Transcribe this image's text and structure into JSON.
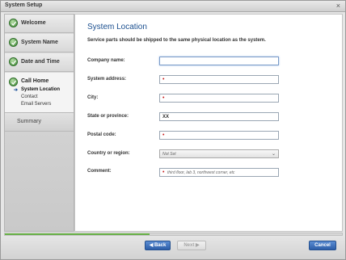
{
  "window": {
    "title": "System Setup",
    "close_glyph": "×"
  },
  "sidebar": {
    "steps": [
      {
        "label": "Welcome",
        "icon": "check-circle-icon"
      },
      {
        "label": "System Name",
        "icon": "check-circle-icon"
      },
      {
        "label": "Date and Time",
        "icon": "check-circle-icon"
      }
    ],
    "current": {
      "label": "Call Home",
      "icon": "check-circle-icon",
      "substeps": [
        {
          "label": "System Location",
          "active": true
        },
        {
          "label": "Contact",
          "active": false
        },
        {
          "label": "Email Servers",
          "active": false
        }
      ]
    },
    "summary": "Summary"
  },
  "main": {
    "title": "System Location",
    "description": "Service parts should be shipped to the same physical location as the system.",
    "fields": [
      {
        "label": "Company name:",
        "value": "",
        "required": false
      },
      {
        "label": "System address:",
        "value": "",
        "required": true
      },
      {
        "label": "City:",
        "value": "",
        "required": true
      },
      {
        "label": "State or province:",
        "value": "XX",
        "required": false
      },
      {
        "label": "Postal code:",
        "value": "",
        "required": true
      },
      {
        "label": "Country or region:",
        "value": "Not Set",
        "type": "select"
      },
      {
        "label": "Comment:",
        "value": "",
        "placeholder": "third floor, lab 3, northwest corner, etc",
        "required": true
      }
    ]
  },
  "progress": {
    "fraction": 0.43
  },
  "footer": {
    "back": "◀ Back",
    "next": "Next ▶",
    "cancel": "Cancel"
  },
  "colors": {
    "accent": "#1b4f8f",
    "button": "#2d5ea8",
    "progress": "#4a9a2b",
    "required": "#c81e1e"
  }
}
